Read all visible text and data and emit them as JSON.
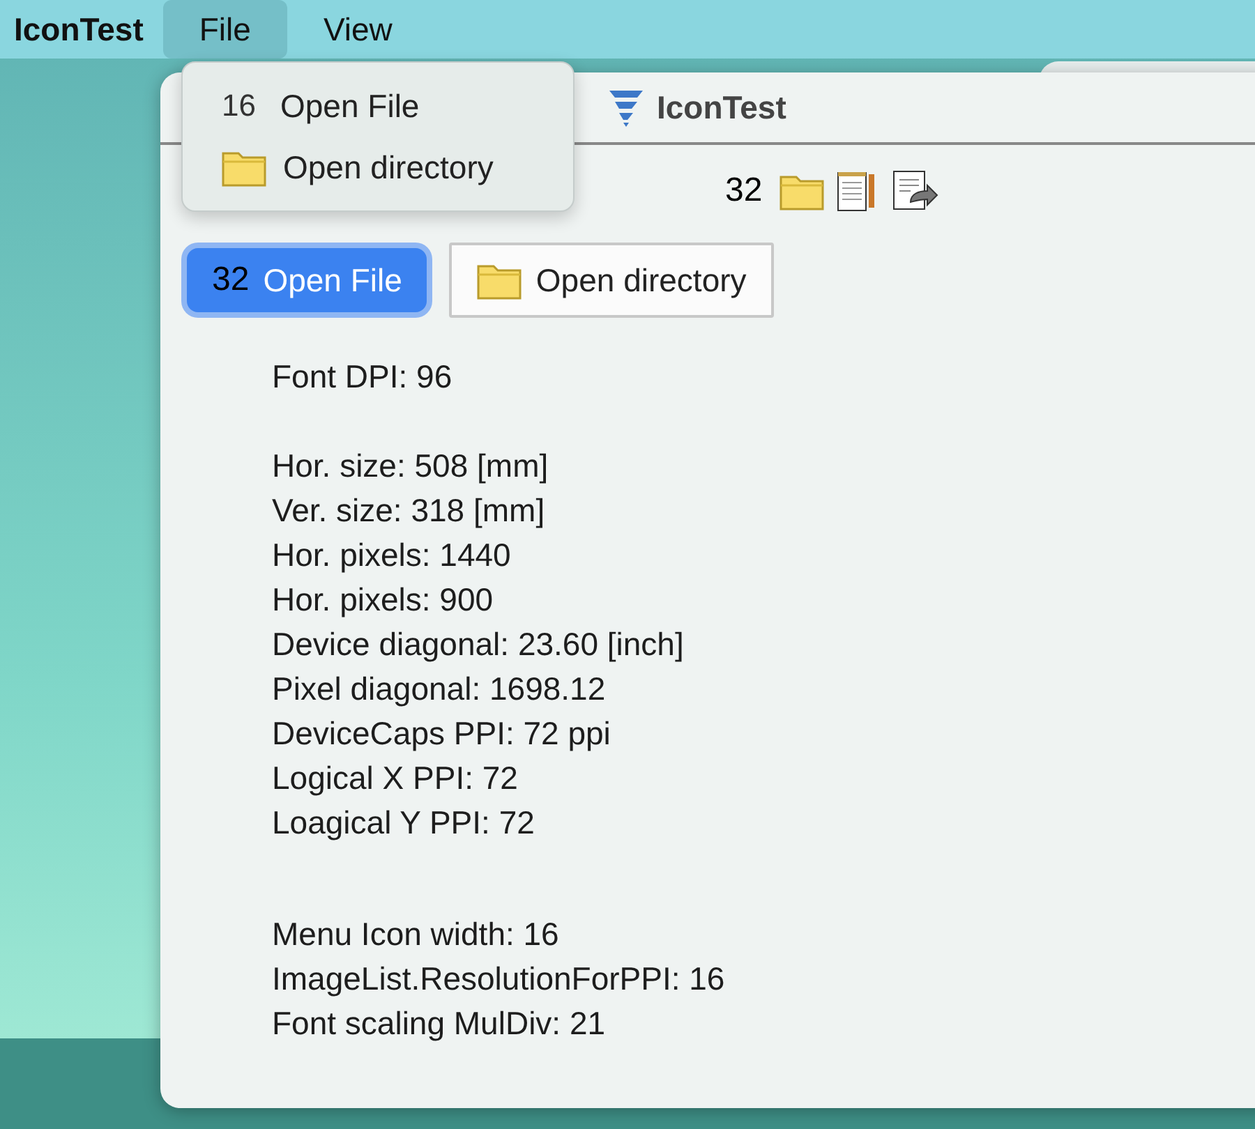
{
  "menu_bar": {
    "app_name": "IconTest",
    "menus": [
      {
        "label": "File",
        "selected": true
      },
      {
        "label": "View",
        "selected": false
      }
    ]
  },
  "dropdown": {
    "items": [
      {
        "kind": "number",
        "icon_text": "16",
        "label": "Open File"
      },
      {
        "kind": "folder",
        "label": "Open directory"
      }
    ]
  },
  "window": {
    "title": "IconTest"
  },
  "toolbar": {
    "size_text": "32"
  },
  "buttons": [
    {
      "kind": "number",
      "icon_text": "32",
      "label": "Open File",
      "selected": true
    },
    {
      "kind": "folder",
      "label": "Open directory",
      "selected": false
    }
  ],
  "info_groups": [
    [
      "Font DPI: 96"
    ],
    [
      "Hor. size: 508 [mm]",
      "Ver. size: 318 [mm]",
      "Hor. pixels: 1440",
      "Hor. pixels: 900",
      "Device diagonal: 23.60 [inch]",
      "Pixel diagonal: 1698.12",
      "DeviceCaps PPI: 72 ppi",
      "Logical X PPI: 72",
      "Loagical Y PPI: 72"
    ],
    [
      "Menu Icon width: 16",
      "ImageList.ResolutionForPPI: 16",
      "Font scaling MulDiv: 21"
    ]
  ]
}
